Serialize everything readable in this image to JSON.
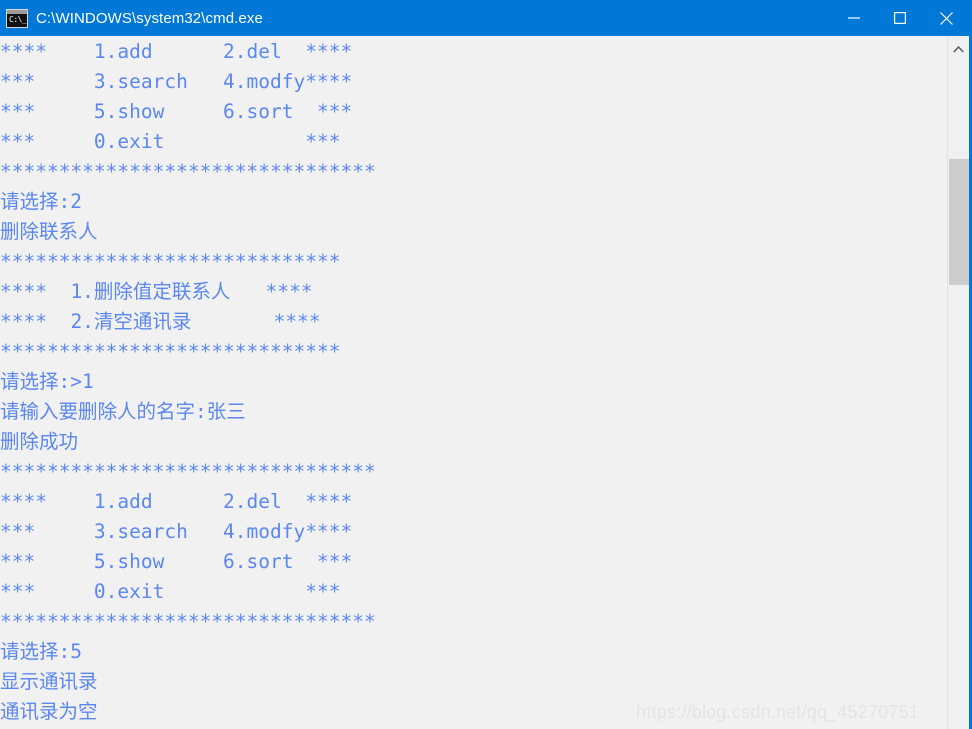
{
  "window": {
    "title": "C:\\WINDOWS\\system32\\cmd.exe",
    "icon_name": "cmd-icon",
    "icon_glyph": "C:\\_",
    "accent_color": "#0078d7",
    "console_bg": "#f1f1f1",
    "console_fg": "#5b87f0",
    "controls": {
      "minimize_label": "Minimize",
      "maximize_label": "Maximize",
      "close_label": "Close"
    }
  },
  "scrollbar": {
    "up_arrow_label": "Scroll up",
    "thumb_label": "Scroll thumb"
  },
  "watermark": {
    "text": "https://blog.csdn.net/qq_45270751"
  },
  "console": {
    "lines": [
      "****    1.add      2.del  ****",
      "***     3.search   4.modfy****",
      "***     5.show     6.sort  ***",
      "***     0.exit            ***",
      "********************************",
      "请选择:2",
      "删除联系人",
      "*****************************",
      "****  1.删除值定联系人   ****",
      "****  2.清空通讯录       ****",
      "*****************************",
      "请选择:>1",
      "请输入要删除人的名字:张三",
      "删除成功",
      "********************************",
      "****    1.add      2.del  ****",
      "***     3.search   4.modfy****",
      "***     5.show     6.sort  ***",
      "***     0.exit            ***",
      "********************************",
      "请选择:5",
      "显示通讯录",
      "通讯录为空"
    ],
    "text": "****    1.add      2.del  ****\n***     3.search   4.modfy****\n***     5.show     6.sort  ***\n***     0.exit            ***\n********************************\n请选择:2\n删除联系人\n*****************************\n****  1.删除值定联系人   ****\n****  2.清空通讯录       ****\n*****************************\n请选择:>1\n请输入要删除人的名字:张三\n删除成功\n********************************\n****    1.add      2.del  ****\n***     3.search   4.modfy****\n***     5.show     6.sort  ***\n***     0.exit            ***\n********************************\n请选择:5\n显示通讯录\n通讯录为空"
  },
  "menu": {
    "items": [
      {
        "key": "1",
        "label": "add"
      },
      {
        "key": "2",
        "label": "del"
      },
      {
        "key": "3",
        "label": "search"
      },
      {
        "key": "4",
        "label": "modfy"
      },
      {
        "key": "5",
        "label": "show"
      },
      {
        "key": "6",
        "label": "sort"
      },
      {
        "key": "0",
        "label": "exit"
      }
    ]
  },
  "delete_menu": {
    "items": [
      {
        "key": "1",
        "label": "删除值定联系人"
      },
      {
        "key": "2",
        "label": "清空通讯录"
      }
    ]
  },
  "session": {
    "prompt_1": "请选择:2",
    "action_1": "删除联系人",
    "prompt_2": "请选择:>1",
    "prompt_name": "请输入要删除人的名字:张三",
    "result_1": "删除成功",
    "prompt_3": "请选择:5",
    "action_2": "显示通讯录",
    "result_2": "通讯录为空",
    "entered_name": "张三"
  }
}
